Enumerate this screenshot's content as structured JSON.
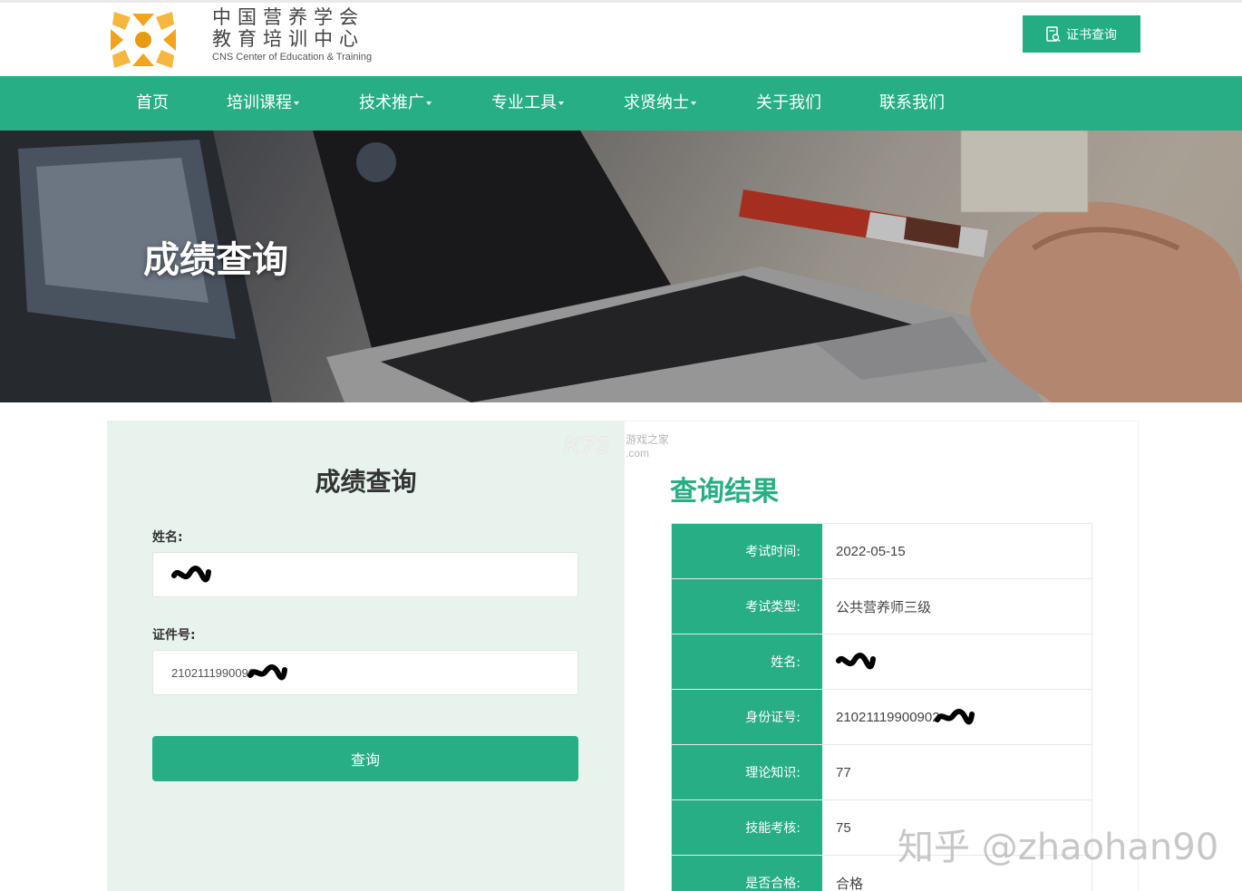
{
  "header": {
    "logo_cn_line1": "中国营养学会",
    "logo_cn_line2": "教育培训中心",
    "logo_en": "CNS Center of Education & Training",
    "cert_button_label": "证书查询"
  },
  "nav": {
    "items": [
      {
        "label": "首页",
        "dropdown": false
      },
      {
        "label": "培训课程",
        "dropdown": true
      },
      {
        "label": "技术推广",
        "dropdown": true
      },
      {
        "label": "专业工具",
        "dropdown": true
      },
      {
        "label": "求贤纳士",
        "dropdown": true
      },
      {
        "label": "关于我们",
        "dropdown": false
      },
      {
        "label": "联系我们",
        "dropdown": false
      }
    ]
  },
  "banner": {
    "title": "成绩查询"
  },
  "form": {
    "title": "成绩查询",
    "name_label": "姓名:",
    "id_label": "证件号:",
    "id_value": "2102111990090",
    "submit_label": "查询"
  },
  "results": {
    "title": "查询结果",
    "rows": [
      {
        "key": "考试时间:",
        "value": "2022-05-15"
      },
      {
        "key": "考试类型:",
        "value": "公共营养师三级"
      },
      {
        "key": "姓名:",
        "value": ""
      },
      {
        "key": "身份证号:",
        "value": "21021119900902"
      },
      {
        "key": "理论知识:",
        "value": "77"
      },
      {
        "key": "技能考核:",
        "value": "75"
      },
      {
        "key": "是否合格:",
        "value": "合格"
      }
    ]
  },
  "watermarks": {
    "k73": "K73",
    "k73_sub": "游戏之家",
    "k73_com": ".com",
    "zhihu": "知乎 @zhaohan90"
  },
  "colors": {
    "brand_green": "#27ae84",
    "form_bg": "#e8f3ee",
    "logo_orange": "#f2a31b"
  }
}
